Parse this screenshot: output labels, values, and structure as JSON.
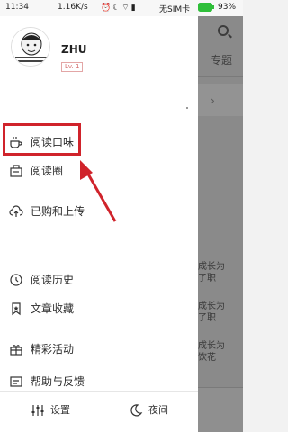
{
  "status_bar": {
    "time": "11:34",
    "network_speed": "1.16K/s",
    "icons": [
      "alarm-icon",
      "moon-icon",
      "wifi-icon",
      "signal-icon"
    ],
    "carrier": "无SIM卡",
    "battery_percent": "93%"
  },
  "drawer": {
    "user": {
      "name": "ZHU",
      "level": "Lv. 1"
    },
    "menu_items": [
      {
        "label": "阅读口味",
        "icon": "coffee-cup-icon"
      },
      {
        "label": "阅读圈",
        "icon": "reading-circle-icon"
      },
      {
        "label": "已购和上传",
        "icon": "cloud-upload-icon"
      },
      {
        "label": "阅读历史",
        "icon": "history-icon"
      },
      {
        "label": "文章收藏",
        "icon": "bookmark-icon"
      },
      {
        "label": "精彩活动",
        "icon": "gift-icon"
      },
      {
        "label": "帮助与反馈",
        "icon": "feedback-icon"
      }
    ],
    "footer": {
      "settings_label": "设置",
      "night_label": "夜间"
    }
  },
  "background_app": {
    "topic_tab": "专题",
    "text_snippets": [
      "成长为",
      "了职",
      "成长为",
      "了职",
      "成长为",
      "饮花"
    ]
  },
  "colors": {
    "highlight": "#d0232b",
    "level_badge": "#d46b6b",
    "overlay": "#8a8a8a"
  }
}
